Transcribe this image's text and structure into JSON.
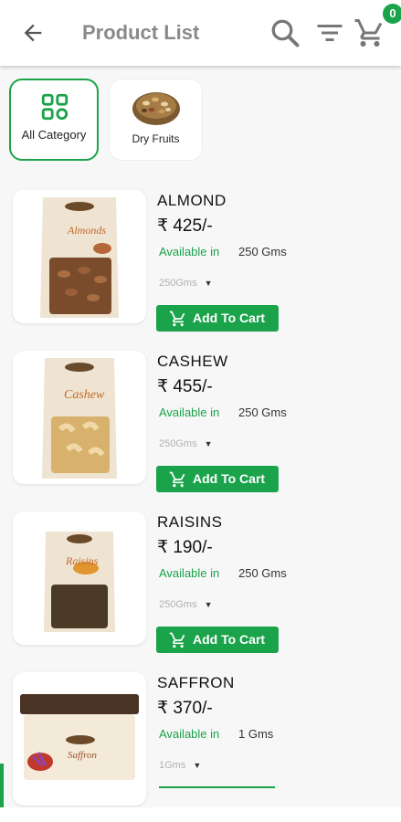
{
  "header": {
    "title": "Product List",
    "cart_count": "0",
    "accent": "#1aa34a"
  },
  "categories": [
    {
      "label": "All Category",
      "icon": "grid-icon",
      "selected": true
    },
    {
      "label": "Dry Fruits",
      "icon": "dry-fruits-image",
      "selected": false
    }
  ],
  "products": [
    {
      "name": "ALMOND",
      "price": "₹ 425/-",
      "available_label": "Available in",
      "quantity": "250 Gms",
      "selected_weight": "250Gms",
      "add_label": "Add To Cart",
      "pack_label": "Almonds"
    },
    {
      "name": "CASHEW",
      "price": "₹ 455/-",
      "available_label": "Available in",
      "quantity": "250 Gms",
      "selected_weight": "250Gms",
      "add_label": "Add To Cart",
      "pack_label": "Cashew"
    },
    {
      "name": "RAISINS",
      "price": "₹ 190/-",
      "available_label": "Available in",
      "quantity": "250 Gms",
      "selected_weight": "250Gms",
      "add_label": "Add To Cart",
      "pack_label": "Raisins"
    },
    {
      "name": "SAFFRON",
      "price": "₹ 370/-",
      "available_label": "Available in",
      "quantity": "1 Gms",
      "selected_weight": "1Gms",
      "pack_label": "Saffron"
    }
  ]
}
